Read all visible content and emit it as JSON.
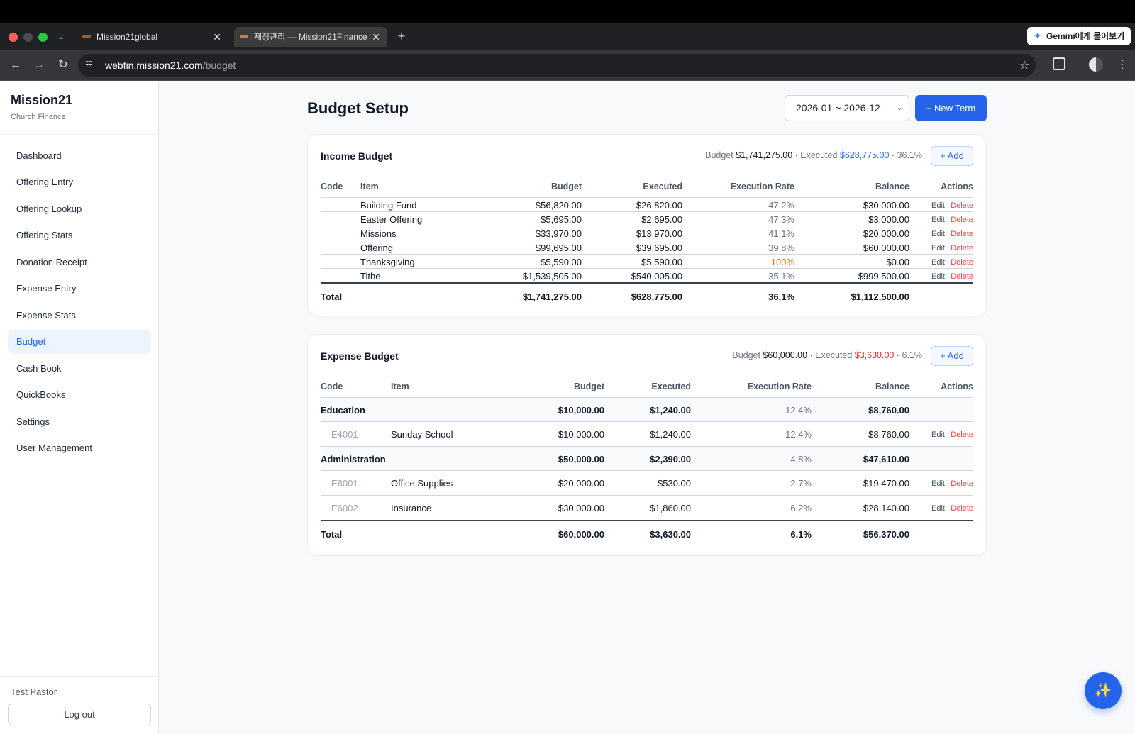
{
  "browser": {
    "tabs": [
      {
        "title": "Mission21global"
      },
      {
        "title": "재정관리 — Mission21Finance"
      }
    ],
    "tab_close": "✕",
    "new_tab": "+",
    "gemini_label": "Gemini에게 물어보기",
    "url_host": "webfin.mission21.com",
    "url_path": "/budget"
  },
  "sidebar": {
    "brand": "Mission21",
    "subtitle": "Church Finance",
    "items": [
      {
        "label": "Dashboard"
      },
      {
        "label": "Offering Entry"
      },
      {
        "label": "Offering Lookup"
      },
      {
        "label": "Offering Stats"
      },
      {
        "label": "Donation Receipt"
      },
      {
        "label": "Expense Entry"
      },
      {
        "label": "Expense Stats"
      },
      {
        "label": "Budget",
        "active": true
      },
      {
        "label": "Cash Book"
      },
      {
        "label": "QuickBooks"
      },
      {
        "label": "Settings"
      },
      {
        "label": "User Management"
      }
    ],
    "user_name": "Test Pastor",
    "logout_label": "Log out"
  },
  "header": {
    "title": "Budget Setup",
    "term_selected": "2026-01 ~ 2026-12",
    "new_term_label": "+ New Term"
  },
  "income": {
    "title": "Income Budget",
    "summary_budget_label": "Budget",
    "summary_budget": "$1,741,275.00",
    "summary_executed_label": "· Executed",
    "summary_executed": "$628,775.00",
    "summary_rate": "· 36.1%",
    "add_label": "+ Add",
    "columns": {
      "code": "Code",
      "item": "Item",
      "budget": "Budget",
      "executed": "Executed",
      "rate": "Execution Rate",
      "balance": "Balance",
      "actions": "Actions"
    },
    "rows": [
      {
        "code": "",
        "item": "Building Fund",
        "budget": "$56,820.00",
        "executed": "$26,820.00",
        "rate": "47.2%",
        "balance": "$30,000.00"
      },
      {
        "code": "",
        "item": "Easter Offering",
        "budget": "$5,695.00",
        "executed": "$2,695.00",
        "rate": "47.3%",
        "balance": "$3,000.00"
      },
      {
        "code": "",
        "item": "Missions",
        "budget": "$33,970.00",
        "executed": "$13,970.00",
        "rate": "41.1%",
        "balance": "$20,000.00"
      },
      {
        "code": "",
        "item": "Offering",
        "budget": "$99,695.00",
        "executed": "$39,695.00",
        "rate": "39.8%",
        "balance": "$60,000.00"
      },
      {
        "code": "",
        "item": "Thanksgiving",
        "budget": "$5,590.00",
        "executed": "$5,590.00",
        "rate": "100%",
        "balance": "$0.00",
        "highlight": true
      },
      {
        "code": "",
        "item": "Tithe",
        "budget": "$1,539,505.00",
        "executed": "$540,005.00",
        "rate": "35.1%",
        "balance": "$999,500.00"
      }
    ],
    "total": {
      "label": "Total",
      "budget": "$1,741,275.00",
      "executed": "$628,775.00",
      "rate": "36.1%",
      "balance": "$1,112,500.00"
    }
  },
  "expense": {
    "title": "Expense Budget",
    "summary_budget_label": "Budget",
    "summary_budget": "$60,000.00",
    "summary_executed_label": "· Executed",
    "summary_executed": "$3,630.00",
    "summary_rate": "· 6.1%",
    "add_label": "+ Add",
    "columns": {
      "code": "Code",
      "item": "Item",
      "budget": "Budget",
      "executed": "Executed",
      "rate": "Execution Rate",
      "balance": "Balance",
      "actions": "Actions"
    },
    "rows": [
      {
        "group": true,
        "code": "Education",
        "item": "",
        "budget": "$10,000.00",
        "executed": "$1,240.00",
        "rate": "12.4%",
        "balance": "$8,760.00"
      },
      {
        "group": false,
        "code": "E4001",
        "item": "Sunday School",
        "budget": "$10,000.00",
        "executed": "$1,240.00",
        "rate": "12.4%",
        "balance": "$8,760.00"
      },
      {
        "group": true,
        "code": "Administration",
        "item": "",
        "budget": "$50,000.00",
        "executed": "$2,390.00",
        "rate": "4.8%",
        "balance": "$47,610.00"
      },
      {
        "group": false,
        "code": "E6001",
        "item": "Office Supplies",
        "budget": "$20,000.00",
        "executed": "$530.00",
        "rate": "2.7%",
        "balance": "$19,470.00"
      },
      {
        "group": false,
        "code": "E6002",
        "item": "Insurance",
        "budget": "$30,000.00",
        "executed": "$1,860.00",
        "rate": "6.2%",
        "balance": "$28,140.00"
      }
    ],
    "total": {
      "label": "Total",
      "budget": "$60,000.00",
      "executed": "$3,630.00",
      "rate": "6.1%",
      "balance": "$56,370.00"
    }
  },
  "row_actions": {
    "edit": "Edit",
    "delete": "Delete"
  },
  "fab_icon": "sparkle-icon"
}
